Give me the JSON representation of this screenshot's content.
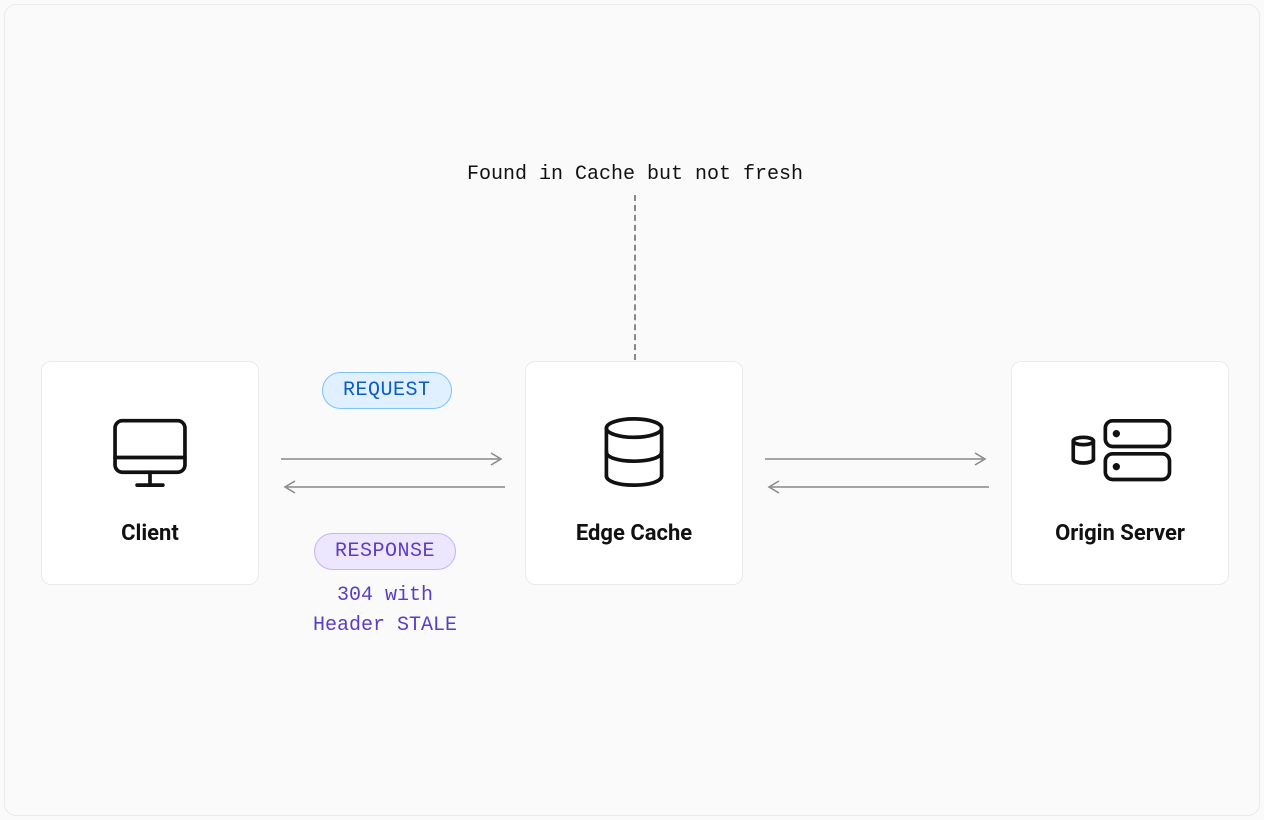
{
  "annotation": "Found in Cache but not fresh",
  "nodes": {
    "client": {
      "label": "Client"
    },
    "edge": {
      "label": "Edge Cache"
    },
    "origin": {
      "label": "Origin Server"
    }
  },
  "pills": {
    "request": "REQUEST",
    "response": "RESPONSE"
  },
  "response_detail_line1": "304 with",
  "response_detail_line2": "Header STALE",
  "colors": {
    "request_bg": "#e0f0ff",
    "request_border": "#7cc3ff",
    "request_text": "#0a5cc6",
    "response_bg": "#ece6ff",
    "response_border": "#c4b3ff",
    "response_text": "#5b3cc4"
  }
}
